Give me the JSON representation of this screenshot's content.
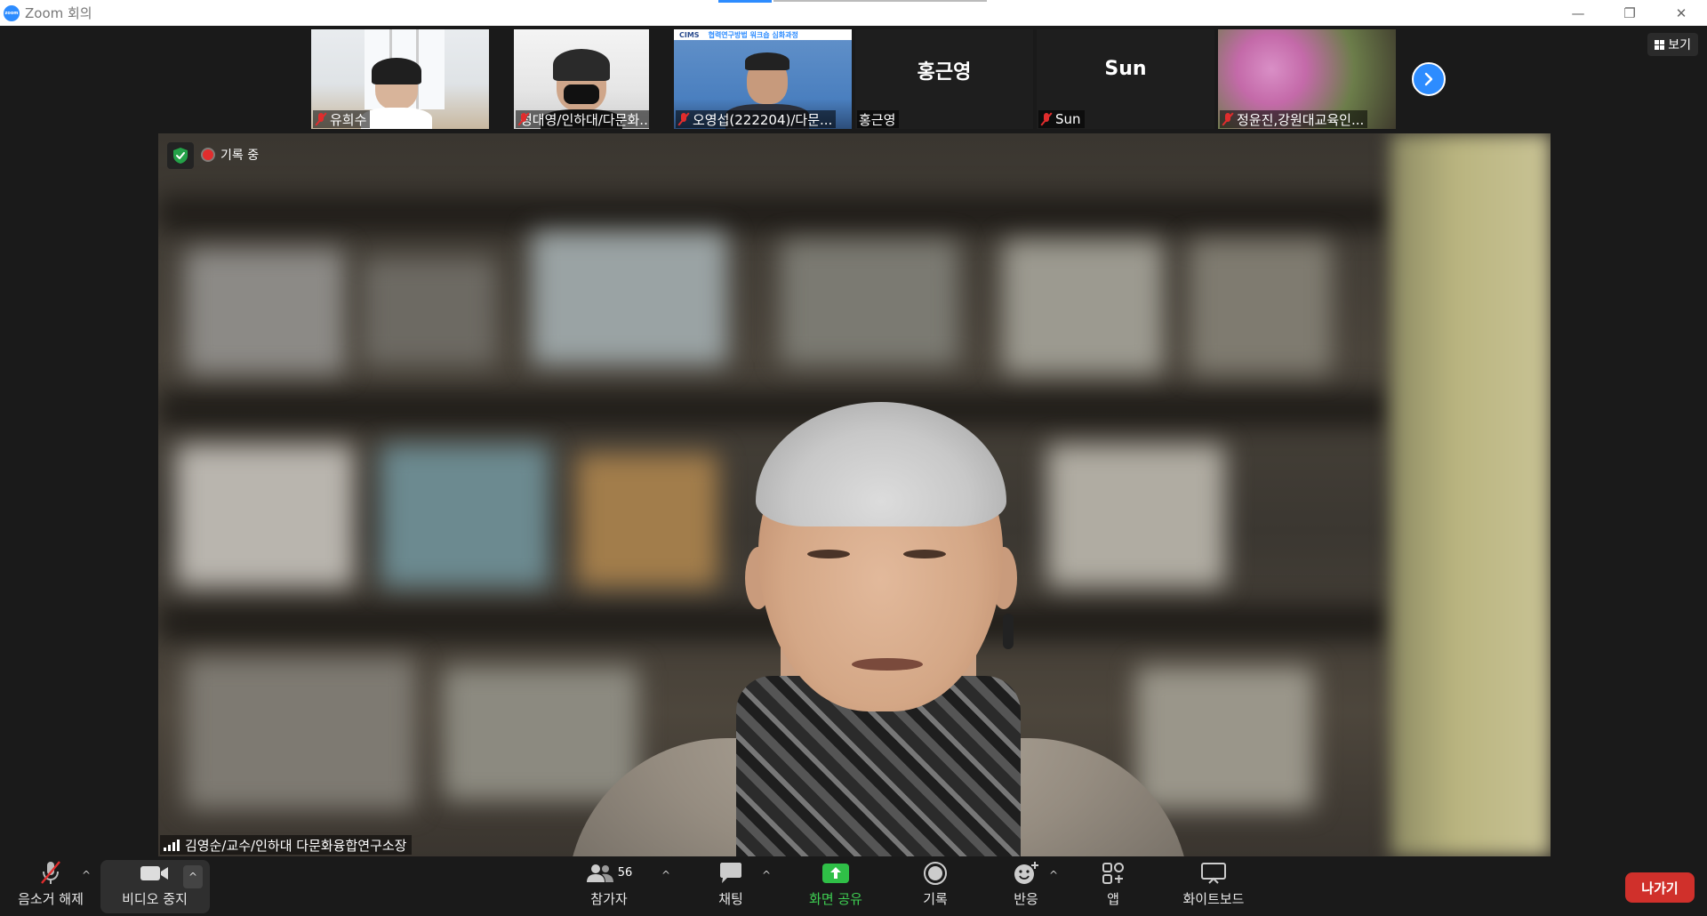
{
  "window": {
    "title": "Zoom 회의",
    "logo_text": "zoom",
    "minimize": "—",
    "restore": "❐",
    "close": "✕"
  },
  "view_button": {
    "label": "보기"
  },
  "thumbnails": [
    {
      "name": "유희수",
      "muted": true
    },
    {
      "name": "정대영/인하대/다문화...",
      "muted": true
    },
    {
      "name": "오영섭(222204)/다문...",
      "muted": true,
      "banner_left": "CIMS",
      "banner_right": "협력연구방법 워크숍 심화과정"
    },
    {
      "name": "홍근영",
      "muted": false,
      "display_name": "홍근영"
    },
    {
      "name": "Sun",
      "muted": true,
      "display_name": "Sun"
    },
    {
      "name": "정윤진,강원대교육인...",
      "muted": true
    }
  ],
  "main_video": {
    "recording_label": "기록 중",
    "speaker_name": "김영순/교수/인하대 다문화융합연구소장"
  },
  "toolbar": {
    "unmute_label": "음소거 해제",
    "video_label": "비디오 중지",
    "participants_label": "참가자",
    "participants_count": "56",
    "chat_label": "채팅",
    "share_label": "화면 공유",
    "record_label": "기록",
    "reactions_label": "반응",
    "apps_label": "앱",
    "whiteboard_label": "화이트보드",
    "leave_label": "나가기",
    "caret": "^"
  },
  "colors": {
    "accent": "#2D8CFF",
    "share_green": "#3ecf52",
    "leave_red": "#d0302b",
    "muted_red": "#e02d2d",
    "secure_green": "#24a148"
  }
}
